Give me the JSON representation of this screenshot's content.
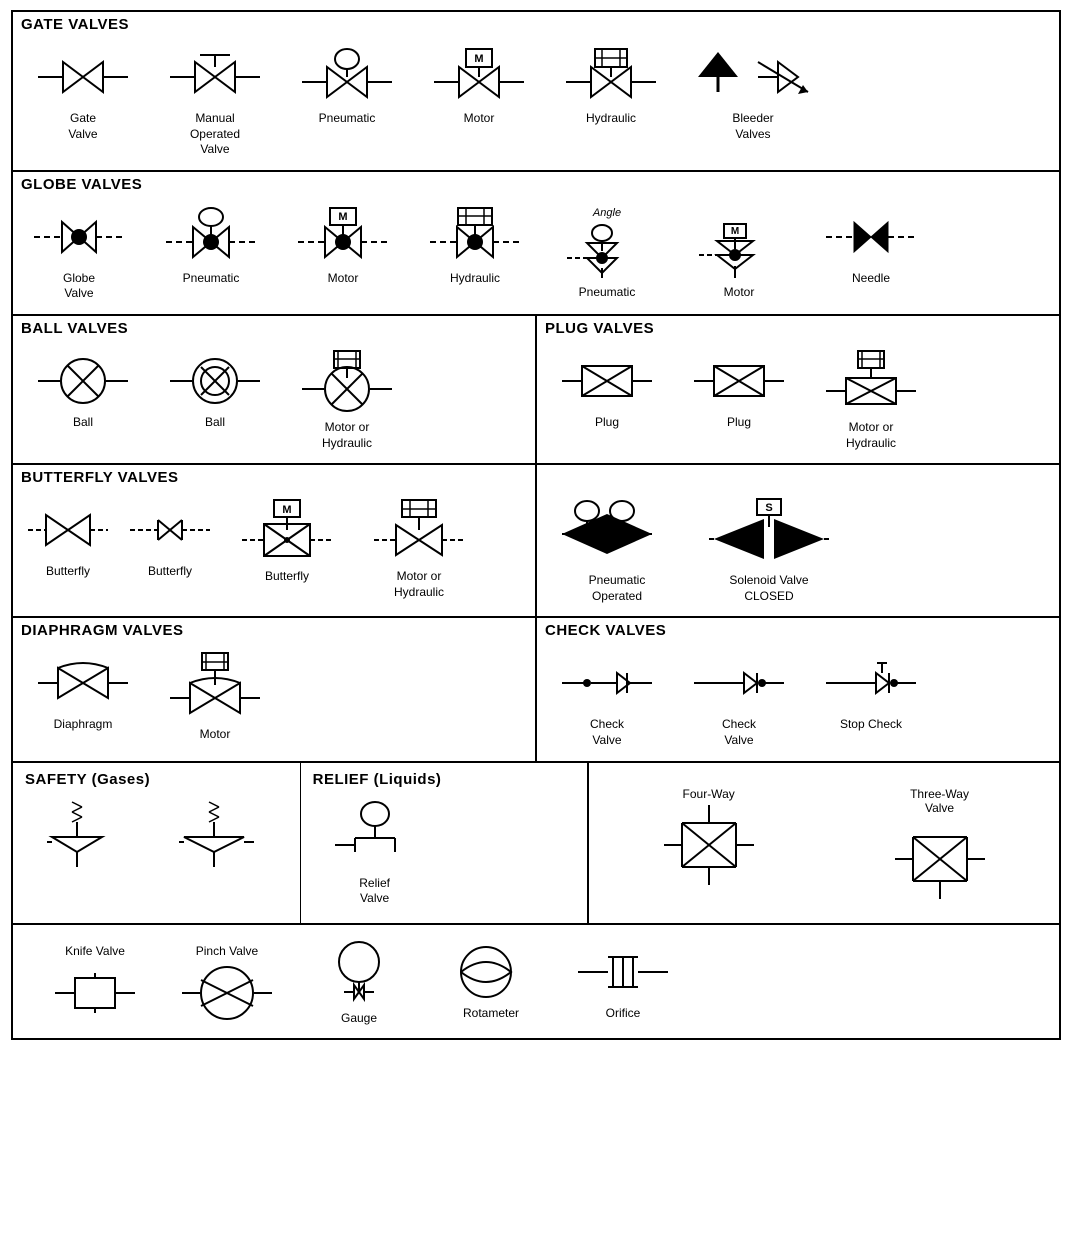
{
  "sections": {
    "gate_valves": {
      "title": "GATE VALVES",
      "items": [
        {
          "label": "Gate\nValve"
        },
        {
          "label": "Manual\nOperated\nValve"
        },
        {
          "label": "Pneumatic"
        },
        {
          "label": "Motor"
        },
        {
          "label": "Hydraulic"
        },
        {
          "label": "Bleeder\nValves"
        }
      ]
    },
    "globe_valves": {
      "title": "GLOBE VALVES",
      "items": [
        {
          "label": "Globe\nValve"
        },
        {
          "label": "Pneumatic"
        },
        {
          "label": "Motor"
        },
        {
          "label": "Hydraulic"
        },
        {
          "label": "Pneumatic"
        },
        {
          "label": "Motor"
        },
        {
          "label": "Needle"
        }
      ]
    },
    "ball_valves": {
      "title": "BALL VALVES",
      "items": [
        {
          "label": "Ball"
        },
        {
          "label": "Ball"
        },
        {
          "label": "Motor or\nHydraulic"
        }
      ]
    },
    "plug_valves": {
      "title": "PLUG VALVES",
      "items": [
        {
          "label": "Plug"
        },
        {
          "label": "Plug"
        },
        {
          "label": "Motor or\nHydraulic"
        }
      ]
    },
    "butterfly_valves": {
      "title": "BUTTERFLY VALVES",
      "items": [
        {
          "label": "Butterfly"
        },
        {
          "label": "Butterfly"
        },
        {
          "label": "Butterfly"
        },
        {
          "label": "Motor or\nHydraulic"
        }
      ]
    },
    "special_valves": {
      "items": [
        {
          "label": "Pneumatic\nOperated"
        },
        {
          "label": "Solenoid Valve\nCLOSED"
        }
      ]
    },
    "diaphragm": {
      "title": "DIAPHRAGM VALVES",
      "items": [
        {
          "label": "Diaphragm"
        },
        {
          "label": "Motor"
        }
      ]
    },
    "check_valves": {
      "title": "CHECK VALVES",
      "items": [
        {
          "label": "Check\nValve"
        },
        {
          "label": "Check\nValve"
        },
        {
          "label": "Stop Check"
        }
      ]
    },
    "safety": {
      "title": "SAFETY (Gases)",
      "items": [
        {
          "label": ""
        },
        {
          "label": ""
        }
      ]
    },
    "relief": {
      "title": "RELIEF (Liquids)",
      "items": [
        {
          "label": "Relief\nValve"
        }
      ]
    },
    "four_three_way": {
      "items": [
        {
          "label": "Four-Way"
        },
        {
          "label": "Three-Way\nValve"
        }
      ]
    },
    "misc": {
      "items": [
        {
          "label": "Knife Valve"
        },
        {
          "label": "Pinch Valve"
        },
        {
          "label": "Gauge"
        },
        {
          "label": "Rotameter"
        },
        {
          "label": "Orifice"
        }
      ]
    }
  }
}
